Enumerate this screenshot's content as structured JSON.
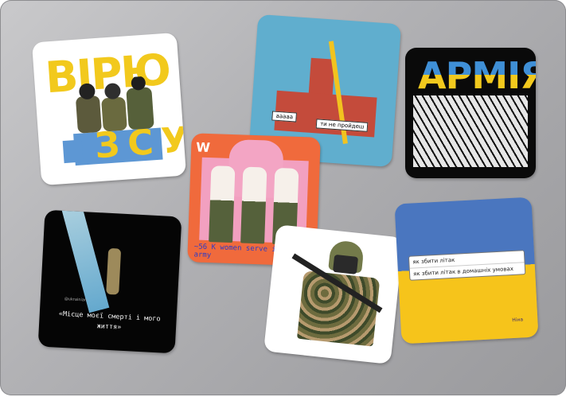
{
  "sticker_virno": {
    "title": "ВІРЮ",
    "small": "в",
    "bottom": "ЗСУ"
  },
  "sticker_kremlin": {
    "sign_left": "ааааа",
    "sign_right": "ти не пройдеш"
  },
  "sticker_armiya": {
    "word": "АРМІЯ"
  },
  "sticker_women": {
    "corner_left": "W",
    "bottom_text": "~56 K women serve in the UA army"
  },
  "sticker_beam": {
    "caption": "«Місце моєї смерті і мого життя»",
    "tag": "@ukrainian"
  },
  "sticker_search": {
    "query1": "як збити літак",
    "query2": "як збити літак в домашніх умовах",
    "signature": "Ніна"
  },
  "colors": {
    "ua_blue": "#4a76bf",
    "ua_yellow": "#f6c41b",
    "laptop": "#b2b2b5"
  }
}
